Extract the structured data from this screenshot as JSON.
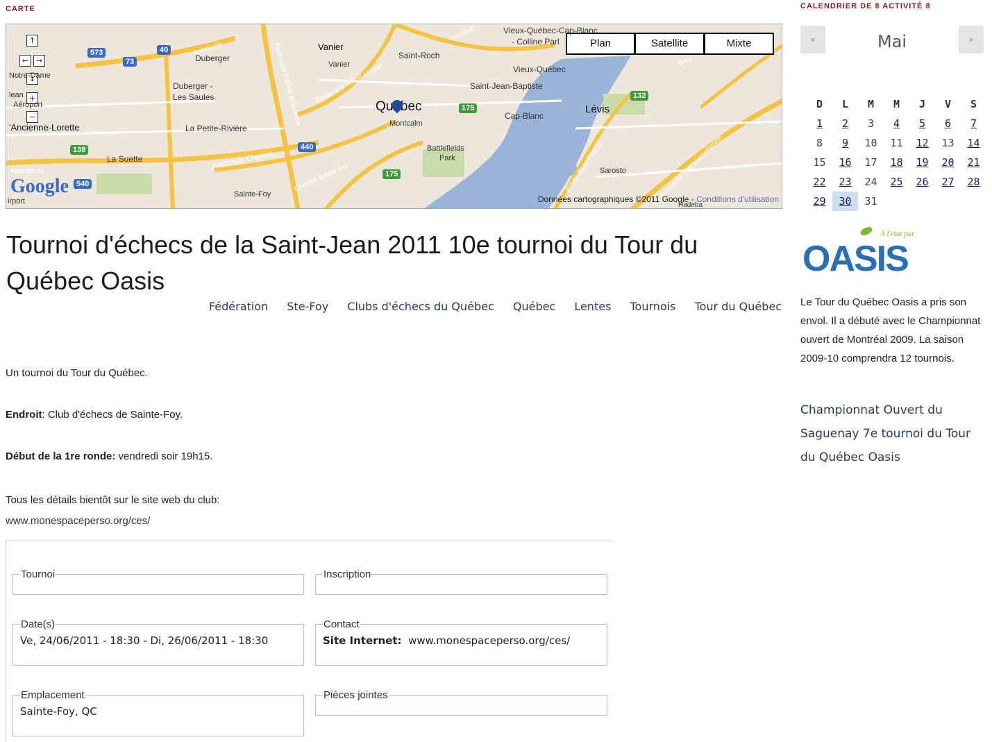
{
  "labels": {
    "carte": "CARTE",
    "calendar": "CALENDRIER DE 8 ACTIVITÉ 8"
  },
  "map": {
    "types": [
      "Plan",
      "Satellite",
      "Mixte"
    ],
    "selected_type": "Plan",
    "copyright": "Données cartographiques ©2011 Google - ",
    "terms": "Conditions d'utilisation",
    "powered": "POWERED BY",
    "google": "Google",
    "places": {
      "quebec": "Québec",
      "levis": "Lévis",
      "vanier1": "Vanier",
      "vanier2": "Vanier",
      "saint_roch": "Saint-Roch",
      "vieux_quebec": "Vieux-Québec",
      "vieux_cap": "Vieux-Québec-Cap-Blanc",
      "colline": "- Colline Parl",
      "sjb": "Saint-Jean-Baptiste",
      "cap_blanc": "Cap-Blanc",
      "montcalm": "Montcalm",
      "battlefields": "Battlefields",
      "park": "Park",
      "duberger": "Duberger",
      "duberger_saules": "Duberger -",
      "saules": "Les Saules",
      "petite_riviere": "La Petite-Rivière",
      "la_suette": "La Suette",
      "ancienne_lorette": "'Ancienne-Lorette",
      "sarosto": "Sarosto",
      "sainte_foy": "Sainte-Foy",
      "notre_dame": "Notre-Dame",
      "leant": "lean",
      "airport": "Aéroport",
      "irport": "irport",
      "autoroute_charest": "Autoroute Charest",
      "chemin_ste_foy": "Chemin Sainte Foy",
      "boul_wilfrid": "Boulevard Wilfrid-Hamel",
      "autoroute": "Autoroute",
      "autoroute_rb": "Autoroute Robert-Bourassa",
      "route_rive": "Route de la Rive S",
      "autoroute_trans": "Autoroute Transcanadienne",
      "hadeba": "Hadeba",
      "rue": "1re Rue",
      "boul": "Boul"
    },
    "shields": [
      "573",
      "73",
      "40",
      "440",
      "138",
      "175",
      "175",
      "132",
      "540"
    ],
    "controls": [
      "up-arrow",
      "left-arrow",
      "right-arrow",
      "down-arrow",
      "zoom-in",
      "zoom-out"
    ]
  },
  "title": "Tournoi d'échecs de la Saint-Jean 2011 10e tournoi du Tour du Québec Oasis",
  "tags": [
    "Fédération",
    "Ste-Foy",
    "Clubs d'échecs du Québec",
    "Québec",
    "Lentes",
    "Tournois",
    "Tour du Québec"
  ],
  "body": {
    "intro": "Un tournoi du Tour du Québec.",
    "endroit_label": "Endroit",
    "endroit_value": ": Club d'échecs de Sainte-Foy.",
    "debut_label": "Début de la 1re ronde:",
    "debut_value": " vendredi soir 19h15.",
    "details": "Tous les détails bientôt sur le site web du club:",
    "details_url": "www.monespaceperso.org/ces/"
  },
  "info": {
    "tournoi_legend": "Tournoi",
    "inscription_legend": "Inscription",
    "dates_legend": "Date(s)",
    "dates_value": "Ve, 24/06/2011 - 18:30 - Di, 26/06/2011 - 18:30",
    "contact_legend": "Contact",
    "contact_label": "Site Internet:",
    "contact_value": "www.monespaceperso.org/ces/",
    "emplacement_legend": "Emplacement",
    "emplacement_value": "Sainte-Foy, QC",
    "pieces_legend": "Pièces jointes"
  },
  "calendar": {
    "prev": "«",
    "next": "»",
    "month": "Mai",
    "weekdays": [
      "D",
      "L",
      "M",
      "M",
      "J",
      "V",
      "S"
    ],
    "weeks": [
      [
        {
          "d": "1",
          "l": true
        },
        {
          "d": "2",
          "l": true
        },
        {
          "d": "3",
          "l": false
        },
        {
          "d": "4",
          "l": true
        },
        {
          "d": "5",
          "l": true
        },
        {
          "d": "6",
          "l": true
        },
        {
          "d": "7",
          "l": true
        }
      ],
      [
        {
          "d": "8",
          "l": false
        },
        {
          "d": "9",
          "l": true
        },
        {
          "d": "10",
          "l": false
        },
        {
          "d": "11",
          "l": false
        },
        {
          "d": "12",
          "l": true
        },
        {
          "d": "13",
          "l": false
        },
        {
          "d": "14",
          "l": true
        }
      ],
      [
        {
          "d": "15",
          "l": false
        },
        {
          "d": "16",
          "l": true
        },
        {
          "d": "17",
          "l": false
        },
        {
          "d": "18",
          "l": true
        },
        {
          "d": "19",
          "l": true
        },
        {
          "d": "20",
          "l": true
        },
        {
          "d": "21",
          "l": true
        }
      ],
      [
        {
          "d": "22",
          "l": true
        },
        {
          "d": "23",
          "l": true
        },
        {
          "d": "24",
          "l": false
        },
        {
          "d": "25",
          "l": true
        },
        {
          "d": "26",
          "l": true
        },
        {
          "d": "27",
          "l": true
        },
        {
          "d": "28",
          "l": true
        }
      ],
      [
        {
          "d": "29",
          "l": true
        },
        {
          "d": "30",
          "l": true,
          "today": true
        },
        {
          "d": "31",
          "l": false
        }
      ]
    ]
  },
  "sidebar": {
    "logo_text": "OASIS",
    "logo_tag": "À l'état pur",
    "text": "Le Tour du Québec Oasis a pris son envol. Il a débuté avec le Championnat ouvert de Montréal 2009. La saison 2009-10 comprendra 12 tournois.",
    "link": "Championnat Ouvert du Saguenay 7e tournoi du Tour du Québec Oasis"
  },
  "colors": {
    "label": "#8b1a1a",
    "water": "#9ab4d8",
    "highway": "#f5c242",
    "park": "#c8dcaa"
  }
}
